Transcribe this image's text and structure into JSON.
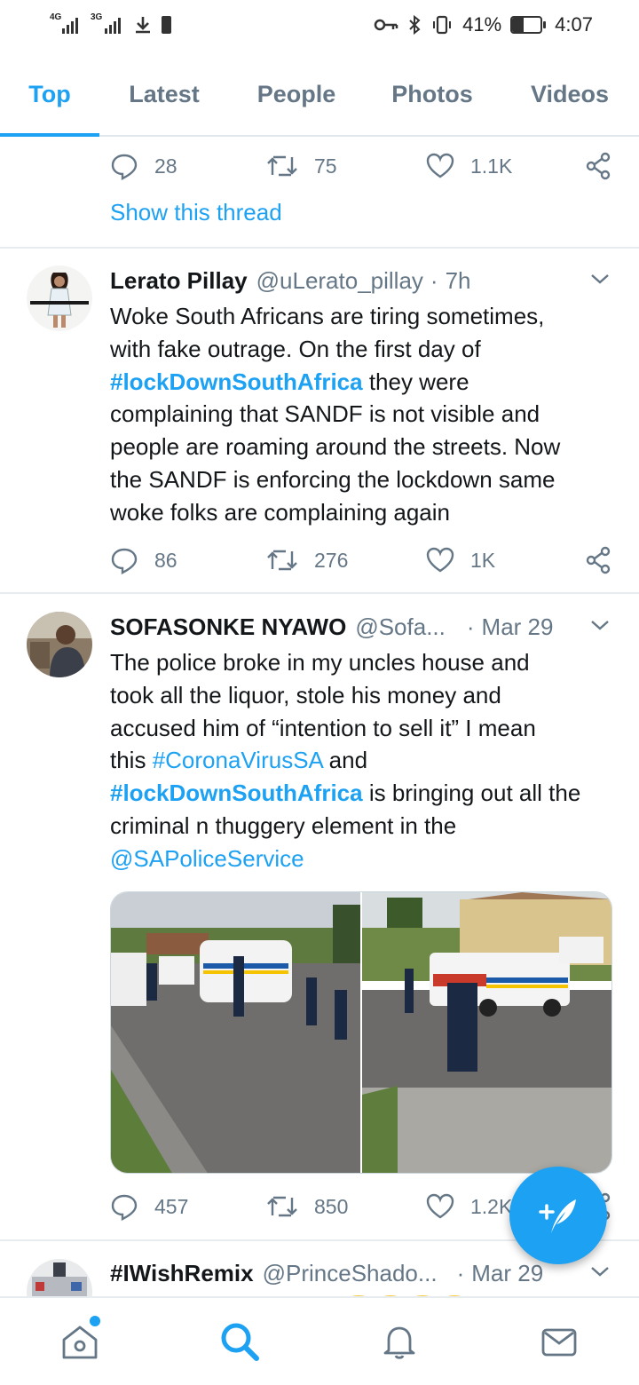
{
  "status_bar": {
    "net1": "4G",
    "net2": "3G",
    "battery_percent": "41%",
    "battery_level": 0.41,
    "time": "4:07"
  },
  "tabs": [
    {
      "label": "Top",
      "active": true
    },
    {
      "label": "Latest",
      "active": false
    },
    {
      "label": "People",
      "active": false
    },
    {
      "label": "Photos",
      "active": false
    },
    {
      "label": "Videos",
      "active": false
    }
  ],
  "prev_tweet": {
    "replies": "28",
    "retweets": "75",
    "likes": "1.1K",
    "show_thread": "Show this thread"
  },
  "tweets": [
    {
      "name": "Lerato Pillay",
      "handle": "@uLerato_pillay",
      "time": "7h",
      "text_lines": [
        "Woke South Africans are tiring sometimes,",
        "with fake outrage. On the first day of",
        "#lockDownSouthAfrica",
        " they were",
        "complaining that SANDF is not visible and",
        "people are roaming around the streets. Now",
        "the SANDF is enforcing the lockdown same",
        "woke folks are complaining again"
      ],
      "replies": "86",
      "retweets": "276",
      "likes": "1K"
    },
    {
      "name": "SOFASONKE NYAWO",
      "handle": "@Sofa...",
      "time": "Mar 29",
      "text_parts": {
        "l1": "The police broke in my uncles house and",
        "l2": "took all the liquor, stole his money and",
        "l3": "accused him of “intention to sell it” I mean",
        "l4a": "this ",
        "l4b": "#CoronaVirusSA",
        "l4c": " and",
        "l5a": "#lockDownSouthAfrica",
        "l5b": " is bringing out all the",
        "l6": "criminal n thuggery  element in the",
        "l7": "@SAPoliceService"
      },
      "replies": "457",
      "retweets": "850",
      "likes": "1.2K"
    },
    {
      "name": "#IWishRemix",
      "handle": "@PrinceShado...",
      "time": "Mar 29"
    }
  ],
  "colors": {
    "accent": "#1da1f2",
    "text": "#14171a",
    "muted": "#657786",
    "divider": "#e6ecf0"
  },
  "icons": {
    "reply": "reply-icon",
    "retweet": "retweet-icon",
    "like": "heart-icon",
    "share": "share-icon",
    "compose": "compose-icon"
  }
}
